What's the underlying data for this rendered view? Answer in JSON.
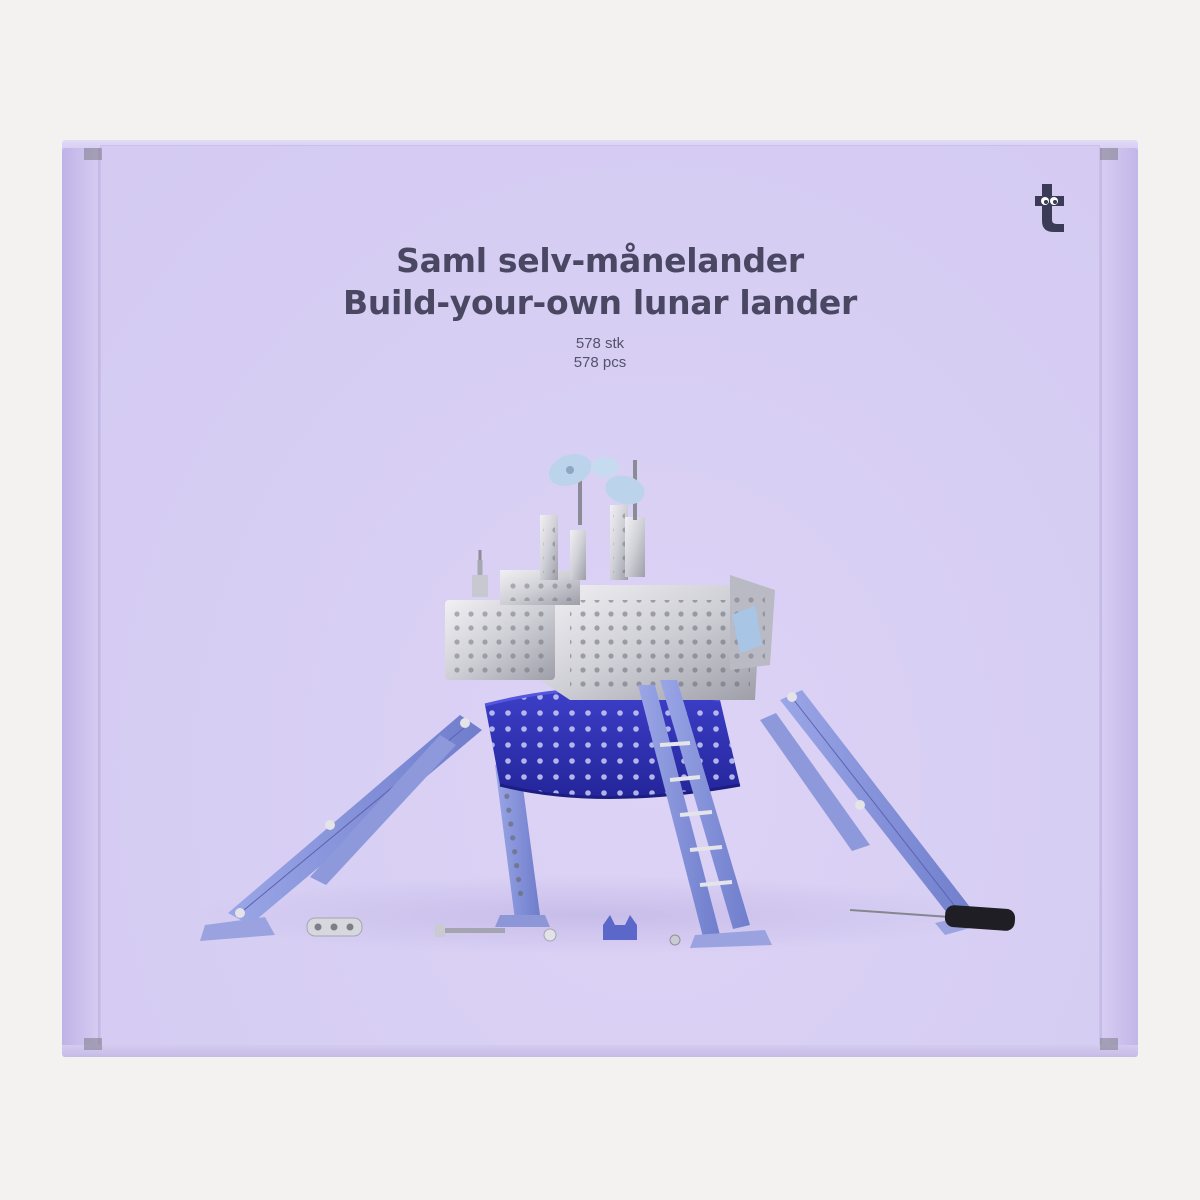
{
  "product": {
    "title_danish": "Saml selv-månelander",
    "title_english": "Build-your-own lunar lander",
    "count_danish": "578 stk",
    "count_english": "578 pcs"
  },
  "brand": {
    "logo_icon": "letter-t-with-eyes-logo"
  },
  "colors": {
    "box_lilac": "#d6ccf2",
    "title_text": "#4a4763",
    "metal_silver": "#d9d9de",
    "metal_blue": "#7f8ed8",
    "base_blue": "#2e2fb3",
    "dish_lightblue": "#bfd6ee"
  }
}
